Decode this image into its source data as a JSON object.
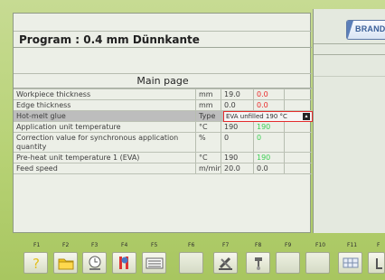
{
  "brand": {
    "name": "BRANDT"
  },
  "program": {
    "title": "Program : 0.4 mm Dünnkante"
  },
  "page": {
    "title": "Main page"
  },
  "table": {
    "rows": [
      {
        "label": "Workpiece thickness",
        "unit": "mm",
        "value": "19.0",
        "extra": "0.0",
        "extra_color": "#ea2b2b"
      },
      {
        "label": "Edge thickness",
        "unit": "mm",
        "value": "0.0",
        "extra": "0.0",
        "extra_color": "#ea2b2b"
      },
      {
        "label": "Hot-melt glue",
        "unit": "Type",
        "value": "EVA unfilled 190 °C"
      },
      {
        "label": "Application unit temperature",
        "unit": "°C",
        "value": "190",
        "extra": "190",
        "extra_color": "#3fcf56"
      },
      {
        "label": "Correction value for synchronous application quantity",
        "unit": "%",
        "value": "0",
        "extra": "0",
        "extra_color": "#3fcf56"
      },
      {
        "label": "Pre-heat unit temperature 1 (EVA)",
        "unit": "°C",
        "value": "190",
        "extra": "190",
        "extra_color": "#3fcf56"
      },
      {
        "label": "Feed speed",
        "unit": "m/min",
        "value": "20.0",
        "extra": "0.0",
        "extra_color": "#3d3d3d"
      }
    ]
  },
  "function_keys": [
    "F1",
    "F2",
    "F3",
    "F4",
    "F5",
    "F6",
    "F7",
    "F8",
    "F9",
    "F10",
    "F11",
    "F"
  ],
  "toolbar": {
    "buttons": [
      {
        "key": "F1",
        "icon": "help-icon"
      },
      {
        "key": "F2",
        "icon": "folder-icon"
      },
      {
        "key": "F3",
        "icon": "clock-icon"
      },
      {
        "key": "F4",
        "icon": "temperature-icon"
      },
      {
        "key": "F5",
        "icon": "keyboard-icon"
      },
      {
        "key": "F6",
        "icon": "blank"
      },
      {
        "key": "F7",
        "icon": "tools-icon"
      },
      {
        "key": "F8",
        "icon": "wrench-icon"
      },
      {
        "key": "F9",
        "icon": "blank"
      },
      {
        "key": "F10",
        "icon": "blank"
      },
      {
        "key": "F11",
        "icon": "grid-icon"
      },
      {
        "key": "F",
        "icon": "partial-tool-icon"
      }
    ]
  }
}
